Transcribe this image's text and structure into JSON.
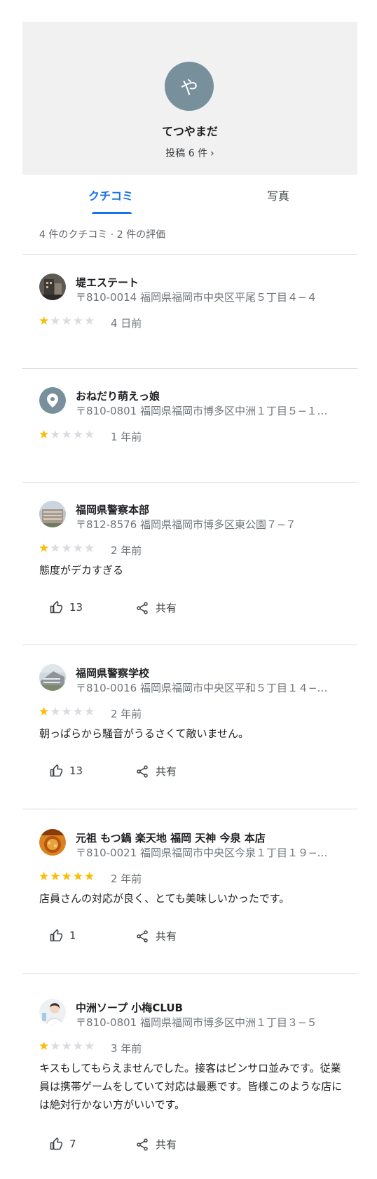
{
  "profile": {
    "avatar_letter": "や",
    "name": "てつやまだ",
    "posts": "投稿 6 件",
    "posts_chevron": "›"
  },
  "tabs": {
    "reviews": "クチコミ",
    "photos": "写真"
  },
  "summary": "4 件のクチコミ · 2 件の評価",
  "share_label": "共有",
  "reviews": [
    {
      "name": "堤エステート",
      "address": "〒810-0014 福岡県福岡市中央区平尾５丁目４−４",
      "rating": 1,
      "when": "4 日前",
      "text": "",
      "likes": ""
    },
    {
      "name": "おねだり萌えっ娘",
      "address": "〒810-0801 福岡県福岡市博多区中洲１丁目５−１…",
      "rating": 1,
      "when": "1 年前",
      "text": "",
      "likes": ""
    },
    {
      "name": "福岡県警察本部",
      "address": "〒812-8576 福岡県福岡市博多区東公園７−７",
      "rating": 1,
      "when": "2 年前",
      "text": "態度がデカすぎる",
      "likes": "13"
    },
    {
      "name": "福岡県警察学校",
      "address": "〒810-0016 福岡県福岡市中央区平和５丁目１４−…",
      "rating": 1,
      "when": "2 年前",
      "text": "朝っぱらから騒音がうるさくて敵いません。",
      "likes": "13"
    },
    {
      "name": "元祖 もつ鍋 楽天地 福岡 天神 今泉 本店",
      "address": "〒810-0021 福岡県福岡市中央区今泉１丁目１９−…",
      "rating": 5,
      "when": "2 年前",
      "text": "店員さんの対応が良く、とても美味しいかったです。",
      "likes": "1"
    },
    {
      "name": "中洲ソープ 小梅CLUB",
      "address": "〒810-0801 福岡県福岡市博多区中洲１丁目３−５",
      "rating": 1,
      "when": "3 年前",
      "text": "キスもしてもらえませんでした。接客はピンサロ並みです。従業員は携帯ゲームをしていて対応は最悪です。皆様このような店には絶対行かない方がいいです。",
      "likes": "7"
    }
  ],
  "colors": {
    "accent": "#1a73e8",
    "star": "#fbbc04",
    "star_off": "#dadce0"
  }
}
